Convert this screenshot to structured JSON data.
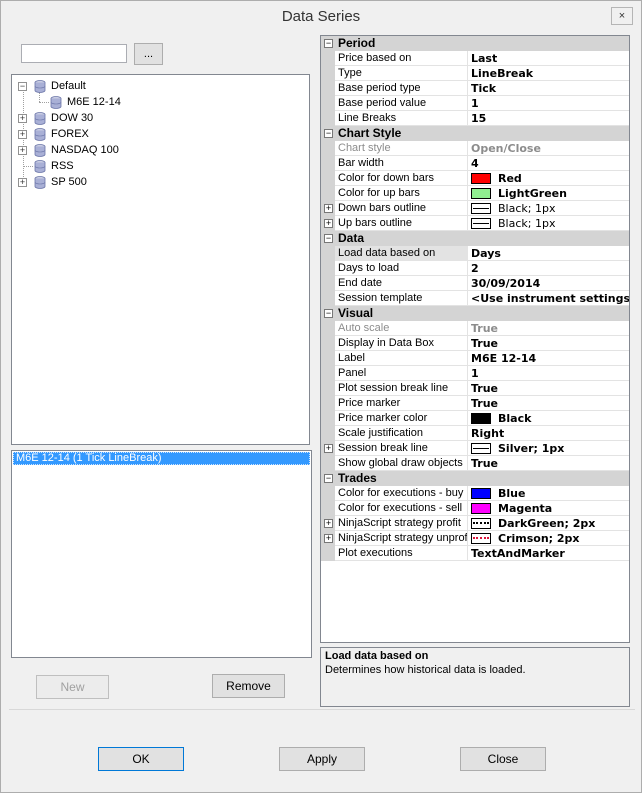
{
  "window": {
    "title": "Data Series",
    "close_glyph": "×"
  },
  "instrument_picker": {
    "search_value": "",
    "browse_label": "..."
  },
  "tree": [
    {
      "label": "Default",
      "expander": "−"
    },
    {
      "label": "M6E 12-14",
      "expander": ""
    },
    {
      "label": "DOW 30",
      "expander": "+"
    },
    {
      "label": "FOREX",
      "expander": "+"
    },
    {
      "label": "NASDAQ 100",
      "expander": "+"
    },
    {
      "label": "RSS",
      "expander": ""
    },
    {
      "label": "SP 500",
      "expander": "+"
    }
  ],
  "series_list": {
    "items": [
      "M6E 12-14 (1 Tick LineBreak)"
    ]
  },
  "buttons": {
    "new": "New",
    "remove": "Remove",
    "ok": "OK",
    "apply": "Apply",
    "close": "Close"
  },
  "grid": {
    "categories": [
      {
        "name": "Period",
        "expander": "−",
        "rows": [
          {
            "name": "Price based on",
            "value": "Last"
          },
          {
            "name": "Type",
            "value": "LineBreak"
          },
          {
            "name": "Base period type",
            "value": "Tick"
          },
          {
            "name": "Base period value",
            "value": "1"
          },
          {
            "name": "Line Breaks",
            "value": "15"
          }
        ]
      },
      {
        "name": "Chart Style",
        "expander": "−",
        "rows": [
          {
            "name": "Chart style",
            "value": "Open/Close",
            "disabled": true
          },
          {
            "name": "Bar width",
            "value": "4"
          },
          {
            "name": "Color for down bars",
            "value": "Red",
            "color": "#ff0000"
          },
          {
            "name": "Color for up bars",
            "value": "LightGreen",
            "color": "#90ee90"
          },
          {
            "name": "Down bars outline",
            "value": "Black; 1px",
            "stroke": "solid",
            "expander": "+",
            "plain": true
          },
          {
            "name": "Up bars outline",
            "value": "Black; 1px",
            "stroke": "solid",
            "expander": "+",
            "plain": true
          }
        ]
      },
      {
        "name": "Data",
        "expander": "−",
        "rows": [
          {
            "name": "Load data based on",
            "value": "Days",
            "selected": true
          },
          {
            "name": "Days to load",
            "value": "2"
          },
          {
            "name": "End date",
            "value": "30/09/2014"
          },
          {
            "name": "Session template",
            "value": "<Use instrument settings>"
          }
        ]
      },
      {
        "name": "Visual",
        "expander": "−",
        "rows": [
          {
            "name": "Auto scale",
            "value": "True",
            "disabled": true
          },
          {
            "name": "Display in Data Box",
            "value": "True"
          },
          {
            "name": "Label",
            "value": "M6E 12-14"
          },
          {
            "name": "Panel",
            "value": "1"
          },
          {
            "name": "Plot session break line",
            "value": "True"
          },
          {
            "name": "Price marker",
            "value": "True"
          },
          {
            "name": "Price marker color",
            "value": "Black",
            "color": "#000000"
          },
          {
            "name": "Scale justification",
            "value": "Right"
          },
          {
            "name": "Session break line",
            "value": "Silver; 1px",
            "stroke": "solid",
            "expander": "+"
          },
          {
            "name": "Show global draw objects",
            "value": "True"
          }
        ]
      },
      {
        "name": "Trades",
        "expander": "−",
        "rows": [
          {
            "name": "Color for executions - buy",
            "value": "Blue",
            "color": "#0000ff"
          },
          {
            "name": "Color for executions - sell",
            "value": "Magenta",
            "color": "#ff00ff"
          },
          {
            "name": "NinjaScript strategy profit",
            "value": "DarkGreen; 2px",
            "stroke": "dot",
            "expander": "+"
          },
          {
            "name": "NinjaScript strategy unprofitable",
            "value": "Crimson; 2px",
            "stroke": "dot",
            "strokeColor": "#dc143c",
            "expander": "+"
          },
          {
            "name": "Plot executions",
            "value": "TextAndMarker"
          }
        ]
      }
    ]
  },
  "description": {
    "title": "Load data based on",
    "text": "Determines how historical data is loaded."
  }
}
